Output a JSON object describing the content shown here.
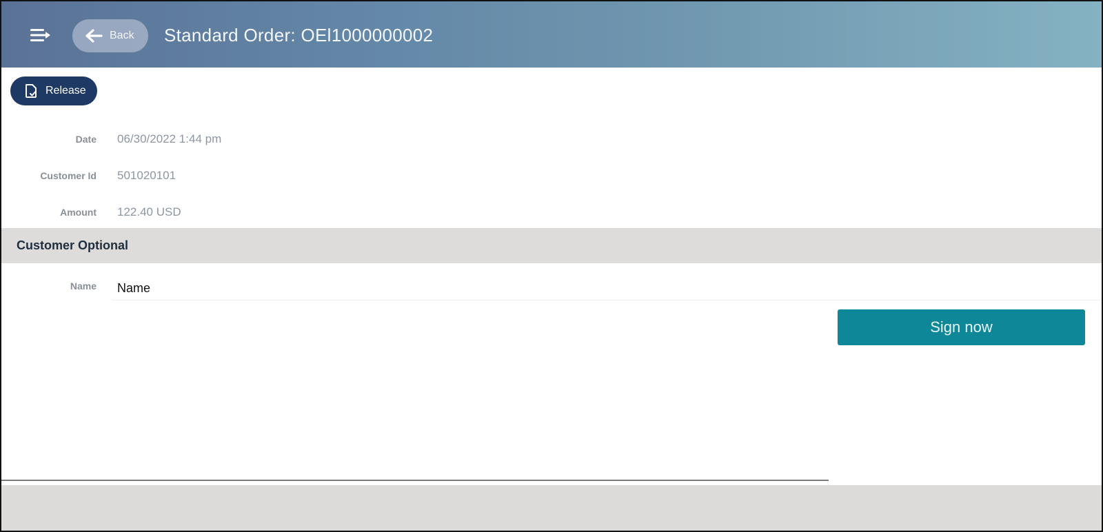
{
  "header": {
    "menu_icon": "menu-arrow-icon",
    "back_icon": "arrow-left-icon",
    "back_label": "Back",
    "title": "Standard Order: OEl1000000002"
  },
  "toolbar": {
    "release_icon": "document-check-icon",
    "release_label": "Release"
  },
  "details": {
    "fields": [
      {
        "label": "Date",
        "value": "06/30/2022 1:44 pm"
      },
      {
        "label": "Customer Id",
        "value": "501020101"
      },
      {
        "label": "Amount",
        "value": "122.40 USD"
      }
    ]
  },
  "customer_optional": {
    "section_title": "Customer Optional",
    "name_label": "Name",
    "name_placeholder": "Name",
    "name_value": ""
  },
  "actions": {
    "sign_label": "Sign now"
  },
  "colors": {
    "header_gradient_start": "#5a7296",
    "header_gradient_end": "#85b2c3",
    "release_button": "#1e3a64",
    "sign_button": "#0e8899",
    "section_background": "#dddcda"
  }
}
